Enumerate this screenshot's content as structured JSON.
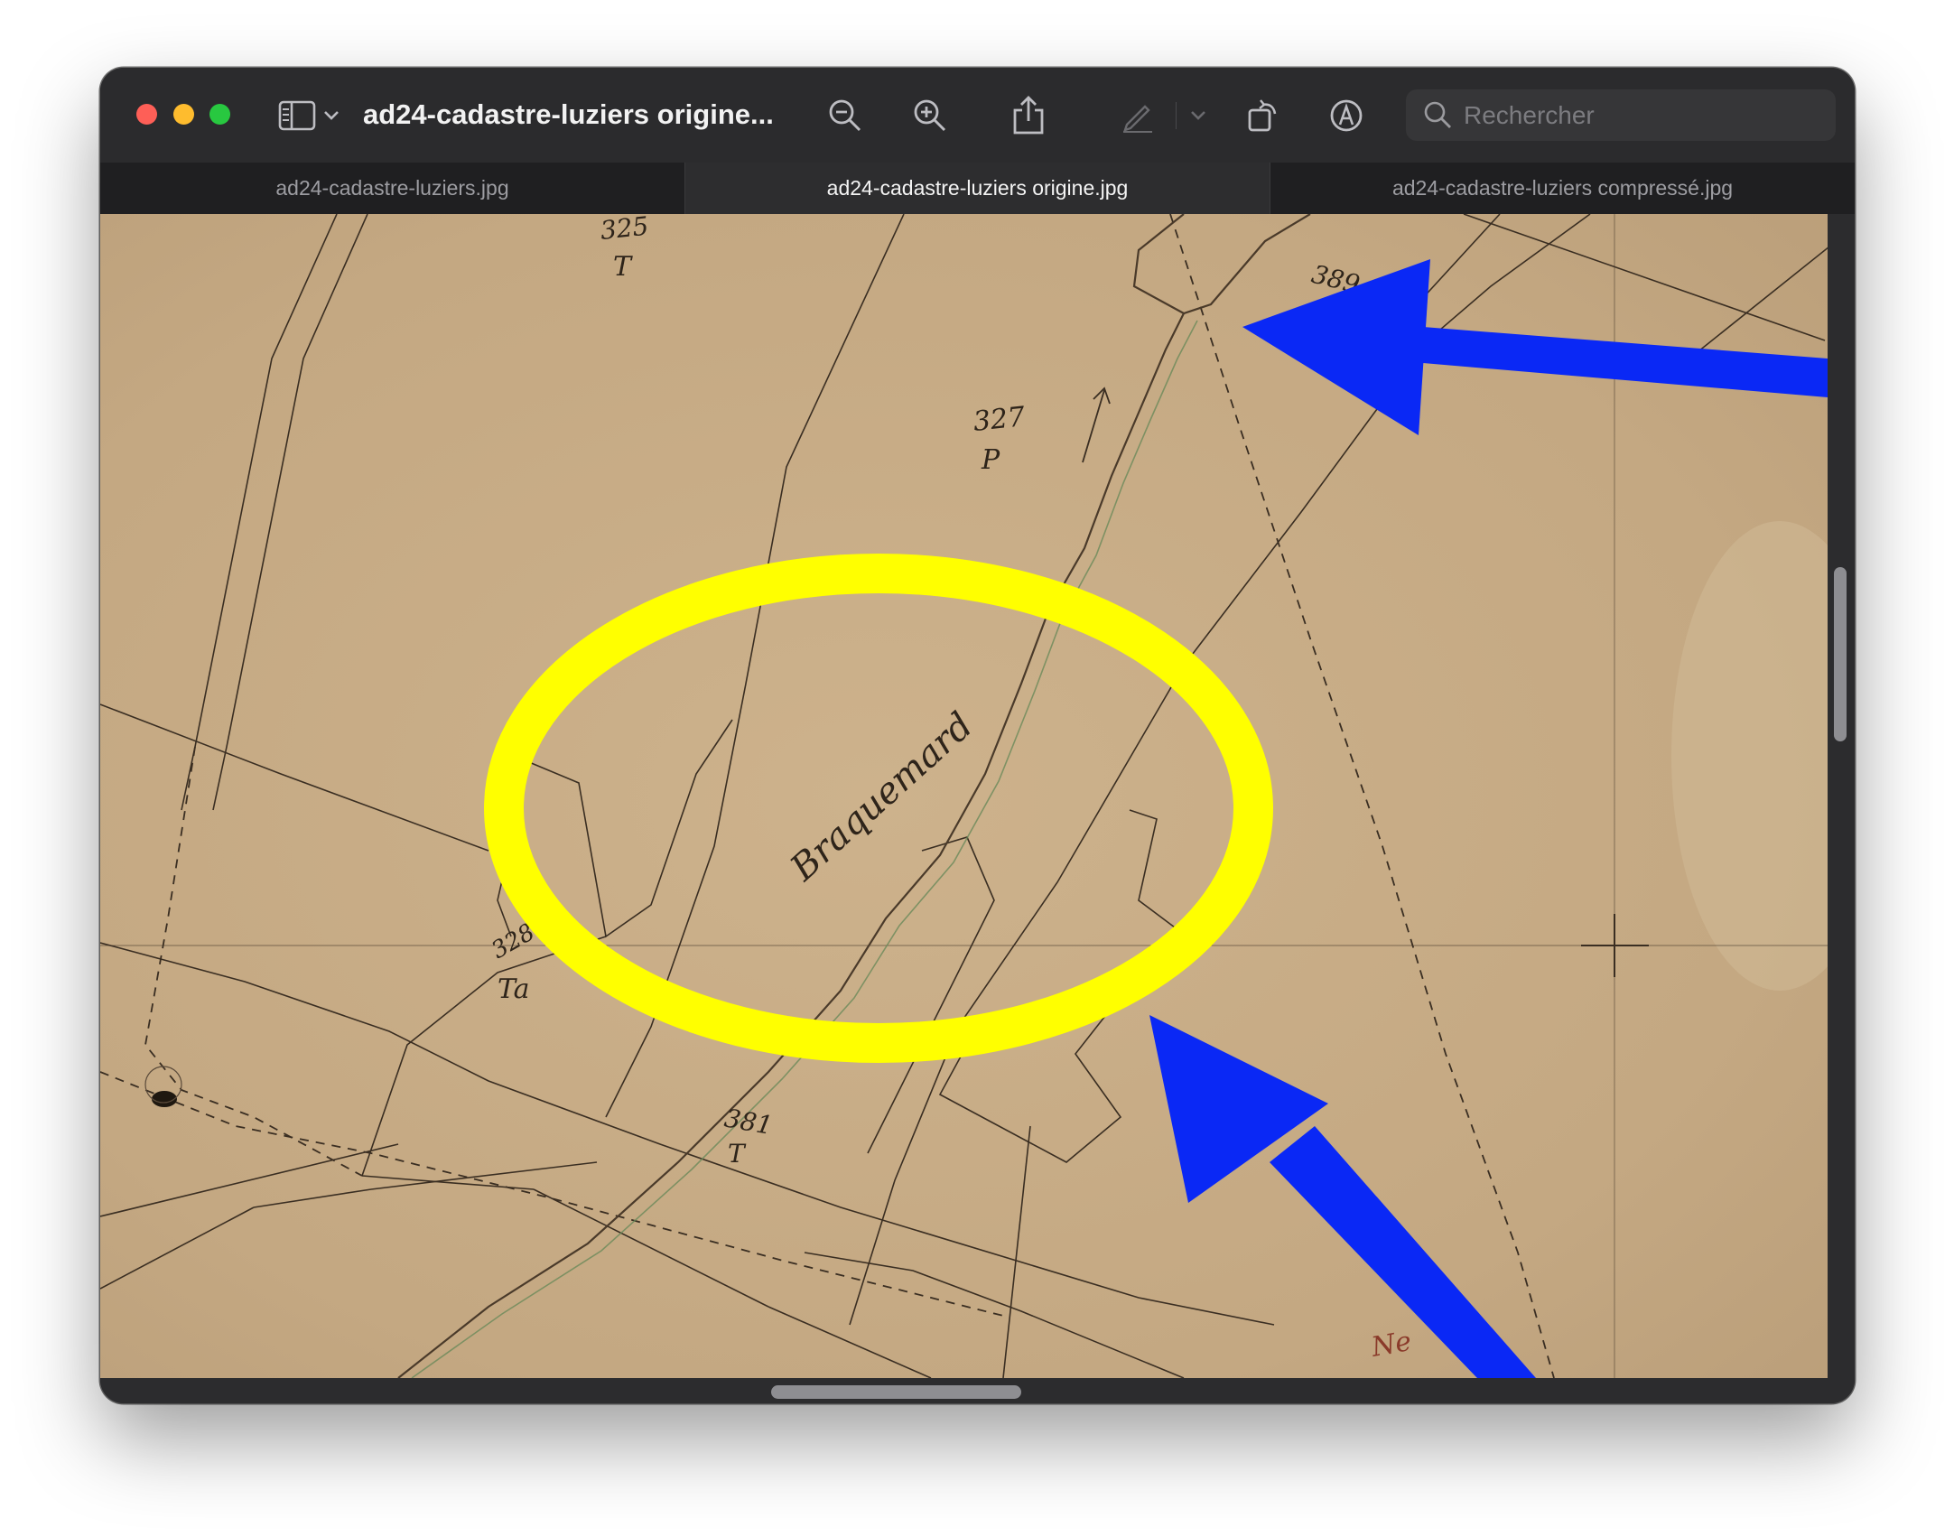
{
  "window": {
    "title": "ad24-cadastre-luziers origine...",
    "search": {
      "placeholder": "Rechercher",
      "value": ""
    }
  },
  "toolbar": {
    "icons": [
      "sidebar-icon",
      "chevron-down-icon",
      "zoom-out-icon",
      "zoom-in-icon",
      "share-icon",
      "markup-pen-icon",
      "chevron-down-icon",
      "rotate-icon",
      "annotate-icon",
      "search-icon"
    ]
  },
  "tabs": [
    {
      "label": "ad24-cadastre-luziers.jpg",
      "active": false
    },
    {
      "label": "ad24-cadastre-luziers origine.jpg",
      "active": true
    },
    {
      "label": "ad24-cadastre-luziers compressé.jpg",
      "active": false
    }
  ],
  "map": {
    "labels": {
      "parcel_325": "325",
      "parcel_325_letter": "T",
      "parcel_327": "327",
      "parcel_327_letter": "P",
      "parcel_389": "389",
      "parcel_328": "328",
      "parcel_328_letter": "Ta",
      "parcel_381": "381",
      "parcel_381_letter": "T",
      "stream_name": "Braquemard",
      "corner_label": "Ne"
    }
  },
  "annotations": {
    "ellipse_color": "#ffff00",
    "arrow_color": "#0a28f5"
  },
  "colors": {
    "paper": "#c6ab86",
    "ink": "#3a2e22",
    "traffic_red": "#fe5f57",
    "traffic_yellow": "#febc2e",
    "traffic_green": "#28c840"
  }
}
